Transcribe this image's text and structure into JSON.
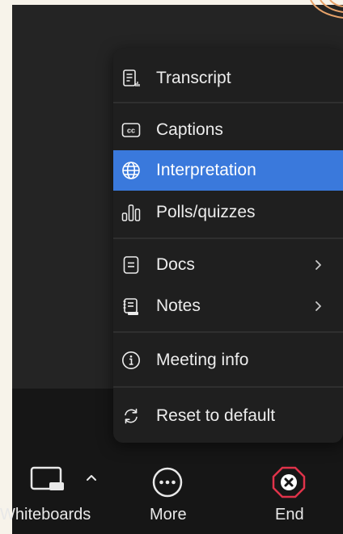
{
  "menu": {
    "items": [
      {
        "label": "Transcript",
        "icon": "transcript-icon"
      },
      {
        "label": "Captions",
        "icon": "captions-icon"
      },
      {
        "label": "Interpretation",
        "icon": "globe-icon",
        "active": true
      },
      {
        "label": "Polls/quizzes",
        "icon": "polls-icon"
      },
      {
        "label": "Docs",
        "icon": "docs-icon",
        "submenu": true
      },
      {
        "label": "Notes",
        "icon": "notes-icon",
        "submenu": true
      },
      {
        "label": "Meeting info",
        "icon": "info-icon"
      },
      {
        "label": "Reset to default",
        "icon": "reset-icon"
      }
    ],
    "captions_icon_text": "cc",
    "active_color": "#3a79dc"
  },
  "toolbar": {
    "whiteboards_label": "Whiteboards",
    "more_label": "More",
    "end_label": "End",
    "end_color": "#e0334a"
  }
}
